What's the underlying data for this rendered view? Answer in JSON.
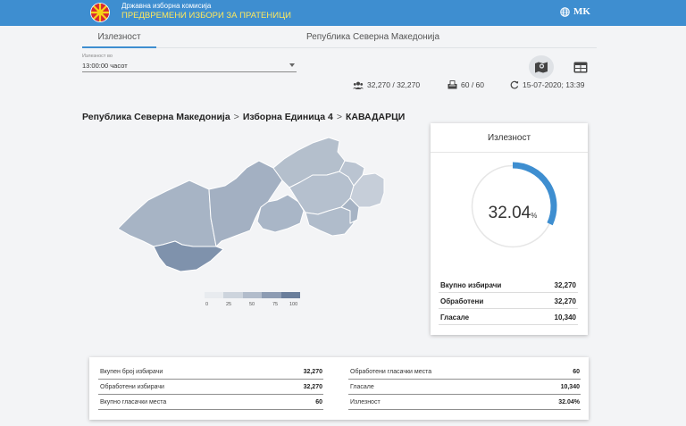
{
  "header": {
    "org_name": "Државна изборна комисија",
    "election_name": "ПРЕДВРЕМЕНИ ИЗБОРИ ЗА ПРАТЕНИЦИ",
    "language": "MK"
  },
  "tabs": [
    {
      "label": "Излезност"
    },
    {
      "label": "Република Северна Македонија"
    }
  ],
  "turnout_select": {
    "label": "Излезност во",
    "value": "13:00:00 часот"
  },
  "stats": {
    "voters": "32,270 / 32,270",
    "polling_stations": "60 / 60",
    "updated": "15-07-2020; 13:39"
  },
  "breadcrumb": {
    "items": [
      "Република Северна Македонија",
      "Изборна Единица 4",
      "КАВАДАРЦИ"
    ]
  },
  "legend": {
    "ticks": [
      "0",
      "25",
      "50",
      "75",
      "100"
    ],
    "colors": [
      "#e8ebef",
      "#cdd4dd",
      "#b2bccb",
      "#8d9cb3",
      "#6a7e9b"
    ]
  },
  "turnout_card": {
    "title": "Излезност",
    "value": "32.04",
    "unit": "%",
    "fraction": 0.3204,
    "rows": [
      {
        "label": "Вкупно избирачи",
        "value": "32,270"
      },
      {
        "label": "Обработени",
        "value": "32,270"
      },
      {
        "label": "Гласале",
        "value": "10,340"
      }
    ]
  },
  "summary": {
    "left": [
      {
        "label": "Вкупен број избирачи",
        "value": "32,270"
      },
      {
        "label": "Обработени избирачи",
        "value": "32,270"
      },
      {
        "label": "Вкупно гласачки места",
        "value": "60"
      }
    ],
    "right": [
      {
        "label": "Обработени гласачки места",
        "value": "60"
      },
      {
        "label": "Гласале",
        "value": "10,340"
      },
      {
        "label": "Излезност",
        "value": "32.04%"
      }
    ]
  },
  "colors": {
    "header_bg": "#3e8ed0",
    "title_yellow": "#ffe85c",
    "accent_blue": "#3e8ed0",
    "map_base": "#a9b6c6"
  }
}
